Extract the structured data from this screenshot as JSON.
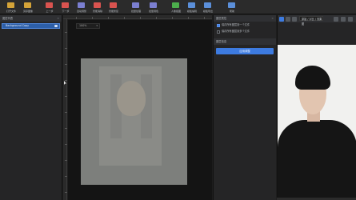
{
  "toolbar": {
    "items": [
      {
        "label": "打开文件",
        "icon": "folder-icon",
        "color": "#d4a338"
      },
      {
        "label": "另存图像",
        "icon": "save-icon",
        "color": "#d4a338"
      },
      {
        "label": "上一步",
        "icon": "undo-icon",
        "color": "#d9534f"
      },
      {
        "label": "下一步",
        "icon": "redo-icon",
        "color": "#d9534f"
      },
      {
        "label": "自动调整",
        "icon": "adjust-icon",
        "color": "#7b7fd1"
      },
      {
        "label": "智能消除",
        "icon": "erase-icon",
        "color": "#d9534f"
      },
      {
        "label": "智能修复",
        "icon": "repair-icon",
        "color": "#d9534f"
      },
      {
        "label": "批量处理",
        "icon": "batch-icon",
        "color": "#7b7fd1"
      },
      {
        "label": "批量调色",
        "icon": "color-icon",
        "color": "#7b7fd1"
      },
      {
        "label": "人像抠图",
        "icon": "cutout-icon",
        "color": "#4cae4c"
      },
      {
        "label": "模板编辑",
        "icon": "template-icon",
        "color": "#5b8fd9"
      },
      {
        "label": "模板导出",
        "icon": "export-icon",
        "color": "#5b8fd9"
      },
      {
        "label": "帮助",
        "icon": "help-icon",
        "color": "#5b8fd9"
      }
    ]
  },
  "layers": {
    "title": "图层列表",
    "items": [
      {
        "label": "Background Copy"
      }
    ]
  },
  "canvas": {
    "zoom": "100%"
  },
  "properties": {
    "title": "图层属性",
    "options": [
      {
        "label": "保存所有图层到一个文件",
        "checked": true
      },
      {
        "label": "保存所有图层到多个文件",
        "checked": false
      }
    ],
    "section": "图层信息",
    "apply_label": "应用调整"
  },
  "preview": {
    "mode_label": "原始 / 对比 / 效果图"
  }
}
